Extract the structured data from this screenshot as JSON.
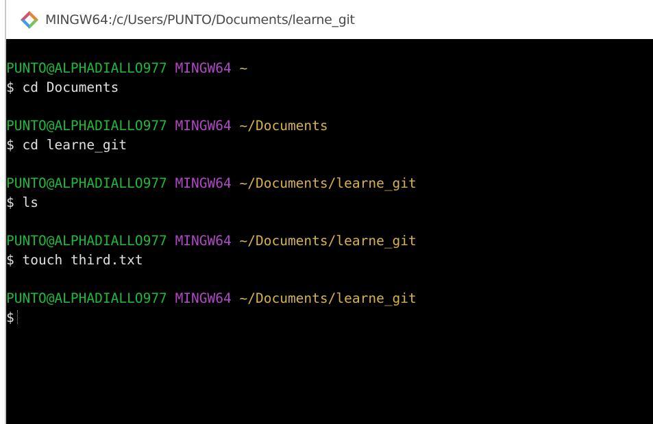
{
  "window": {
    "title": "MINGW64:/c/Users/PUNTO/Documents/learne_git",
    "icon": "git-bash-icon"
  },
  "terminal": {
    "entries": [
      {
        "user": "PUNTO@ALPHADIALLO977",
        "host": "MINGW64",
        "path": "~",
        "prompt": "$",
        "command": "cd Documents"
      },
      {
        "user": "PUNTO@ALPHADIALLO977",
        "host": "MINGW64",
        "path": "~/Documents",
        "prompt": "$",
        "command": "cd learne_git"
      },
      {
        "user": "PUNTO@ALPHADIALLO977",
        "host": "MINGW64",
        "path": "~/Documents/learne_git",
        "prompt": "$",
        "command": "ls"
      },
      {
        "user": "PUNTO@ALPHADIALLO977",
        "host": "MINGW64",
        "path": "~/Documents/learne_git",
        "prompt": "$",
        "command": "touch third.txt"
      },
      {
        "user": "PUNTO@ALPHADIALLO977",
        "host": "MINGW64",
        "path": "~/Documents/learne_git",
        "prompt": "$",
        "command": ""
      }
    ]
  },
  "colors": {
    "user": "#1fb83a",
    "host": "#b148c6",
    "path": "#d6b34a",
    "background": "#000000"
  }
}
